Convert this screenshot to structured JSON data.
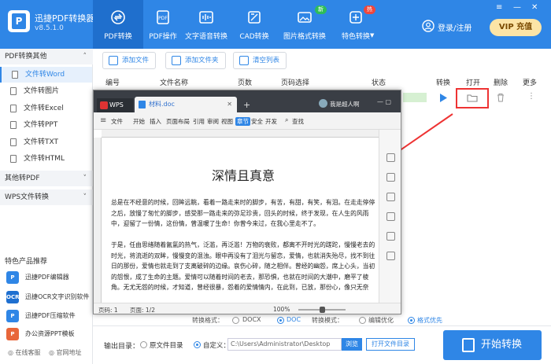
{
  "app": {
    "title": "迅捷PDF转换器",
    "version": "v8.5.1.0"
  },
  "nav": {
    "tabs": [
      {
        "label": "PDF转换",
        "icon": "convert-icon"
      },
      {
        "label": "PDF操作",
        "icon": "pdf-ops-icon"
      },
      {
        "label": "文字语音转换",
        "icon": "text-speech-icon"
      },
      {
        "label": "CAD转换",
        "icon": "cad-icon"
      },
      {
        "label": "图片格式转换",
        "icon": "image-icon"
      },
      {
        "label": "特色转换",
        "icon": "feature-icon"
      }
    ],
    "badge_new": "新",
    "badge_hot": "热",
    "login": "登录/注册",
    "vip": "VIP 充值"
  },
  "sidebar": {
    "group1": "PDF转换其他",
    "items": [
      "文件转Word",
      "文件转图片",
      "文件转Excel",
      "文件转PPT",
      "文件转TXT",
      "文件转HTML"
    ],
    "group2": "其他转PDF",
    "group3": "WPS文件转换",
    "products_title": "特色产品推荐",
    "products": [
      "迅捷PDF编辑器",
      "迅捷OCR文字识别软件",
      "迅捷PDF压缩软件",
      "办公资源PPT模板"
    ],
    "footer": {
      "service": "在线客服",
      "website": "官网地址"
    }
  },
  "toolbar": {
    "add_file": "添加文件",
    "add_folder": "添加文件夹",
    "clear": "清空列表"
  },
  "table": {
    "headers": [
      "编号",
      "文件名称",
      "页数",
      "页码选择",
      "状态",
      "转换",
      "打开",
      "删除",
      "更多"
    ]
  },
  "wps": {
    "app_tab": "WPS",
    "doc_tab": "材料.doc",
    "user": "我是超人啊",
    "ribbon": [
      "文件",
      "开始",
      "插入",
      "页面布局",
      "引用",
      "审阅",
      "视图",
      "章节",
      "安全",
      "开发",
      "查找"
    ],
    "doc_title": "深情且真意",
    "para1": "总是在不经意的时候，回眸远眺，看着一路走来时的脚步，有苦，有甜，有笑，有泪。在走走停停之后，放慢了匆忙的脚步，感受那一路走来的弥足珍贵，回头的时候，终于发现，在人生的风雨中，迎留了一份情，这份情，曾温暖了生命！你曾今来过，在我心里走不了。",
    "para2": "于是，任由思绪随着氤氲的热气，泛滥，再泛滥！万物的衰败，都离不开时光的蹉跎，慢慢老去的时光，将流逝的双眸，慢慢变的混浊。眼中再没有了泪光与留恋，爱情，也就消失殆尽，找不到往日的那份，爱情也就走到了支离破碎的边缘。哀伤心碎，随之相伴。曾经的幽怨，席上心头，当初的怨恨，成了生命的主题。爱情可以随着时间的老去，那恐惧，也就在时间的大潮中，磨平了棱角。无尤无怨的时候，才知道，曾经很暴，怨着的爱情情内，在此到，已放，那份心，像只无奈",
    "status_page": "页码: 1",
    "status_pages": "页面: 1/2",
    "zoom": "100%"
  },
  "bottom": {
    "format_label": "转换格式：",
    "docx": "DOCX",
    "doc": "DOC",
    "mode_label": "转换模式：",
    "mode_edit": "编辑优化",
    "mode_format": "格式优先",
    "output_label": "输出目录：",
    "original_dir": "原文件目录",
    "custom": "自定义：",
    "path": "C:\\Users\\Administrator\\Desktop",
    "browse": "浏览",
    "open_dir": "打开文件目录",
    "start": "开始转换"
  }
}
